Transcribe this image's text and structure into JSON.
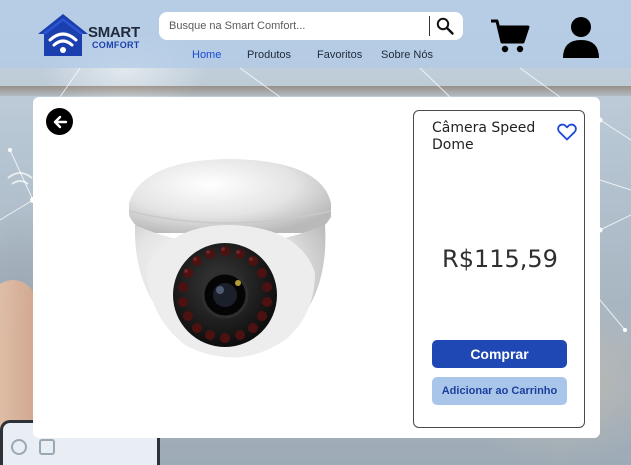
{
  "header": {
    "logo": {
      "line1": "SMART",
      "line2": "COMFORT",
      "icon": "smart-home-wifi-icon"
    },
    "search": {
      "placeholder": "Busque na Smart Comfort...",
      "value": "",
      "icon": "search-icon"
    },
    "nav": [
      {
        "label": "Home",
        "active": true
      },
      {
        "label": "Produtos",
        "active": false
      },
      {
        "label": "Favoritos",
        "active": false
      },
      {
        "label": "Sobre Nós",
        "active": false
      }
    ],
    "cart_icon": "cart-icon",
    "user_icon": "user-icon"
  },
  "product": {
    "back_icon": "arrow-left-icon",
    "image": "dome-security-camera",
    "name": "Câmera Speed Dome",
    "favorite_icon": "heart-outline-icon",
    "price": "R$115,59",
    "buy_label": "Comprar",
    "add_to_cart_label": "Adicionar ao Carrinho"
  },
  "colors": {
    "header_bg": "#b0cae8",
    "nav_active": "#1b48d6",
    "brand_blue": "#1f48b4",
    "buy_button": "#1f48b4",
    "add_cart_button": "#a9c6ea",
    "add_cart_text": "#1c3f9c"
  }
}
